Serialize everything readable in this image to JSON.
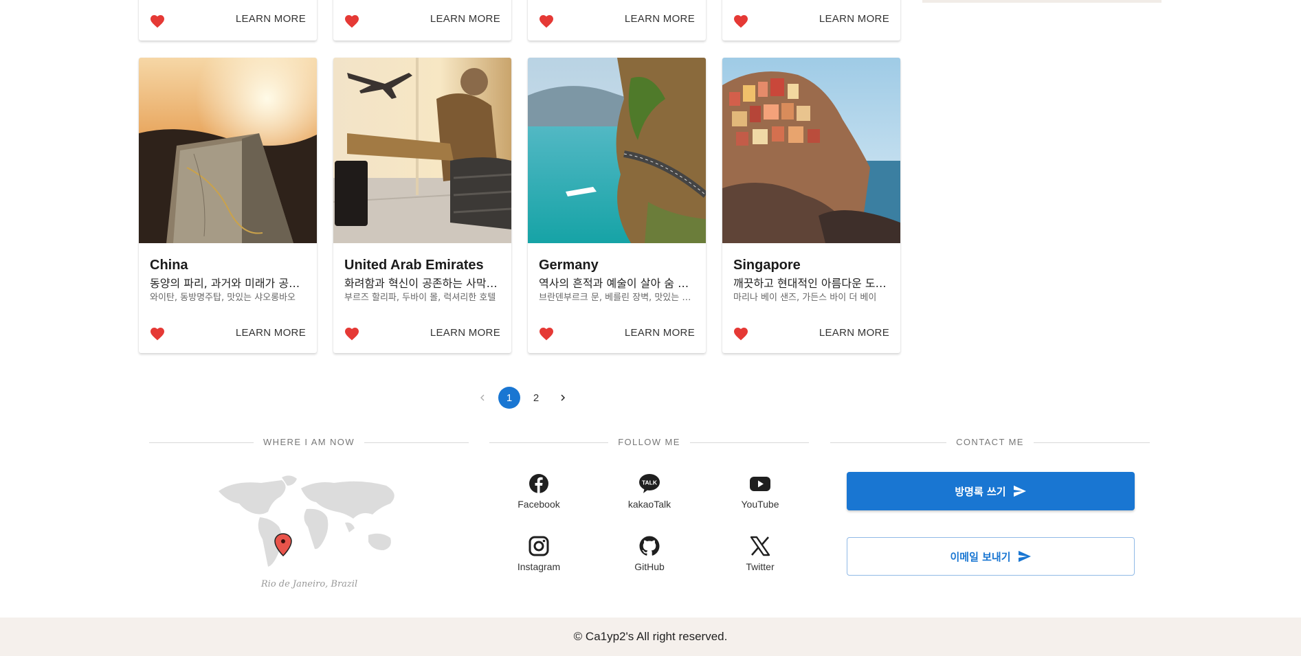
{
  "colors": {
    "accent": "#1976d2",
    "heart": "#e53935",
    "footer_bg": "#f5f0ec"
  },
  "top_row_cards": [
    {
      "learn_more": "LEARN MORE"
    },
    {
      "learn_more": "LEARN MORE"
    },
    {
      "learn_more": "LEARN MORE"
    },
    {
      "learn_more": "LEARN MORE"
    }
  ],
  "cards": [
    {
      "title": "China",
      "subtitle": "동양의 파리, 과거와 미래가 공존하는 도시",
      "description": "와이탄, 동방명주탑, 맛있는 샤오롱바오",
      "learn_more": "LEARN MORE",
      "image": "map-on-dashboard-photo"
    },
    {
      "title": "United Arab Emirates",
      "subtitle": "화려함과 혁신이 공존하는 사막의 도시",
      "description": "부르즈 할리파, 두바이 몰, 럭셔리한 호텔",
      "learn_more": "LEARN MORE",
      "image": "airport-traveler-photo"
    },
    {
      "title": "Germany",
      "subtitle": "역사의 흔적과 예술이 살아 숨 쉬는 나라",
      "description": "브란덴부르크 문, 베를린 장벽, 맛있는 맥주",
      "learn_more": "LEARN MORE",
      "image": "coastal-road-photo"
    },
    {
      "title": "Singapore",
      "subtitle": "깨끗하고 현대적인 아름다운 도시 국가",
      "description": "마리나 베이 샌즈, 가든스 바이 더 베이",
      "learn_more": "LEARN MORE",
      "image": "cliffside-village-photo"
    }
  ],
  "pagination": {
    "pages": [
      "1",
      "2"
    ],
    "current": "1"
  },
  "footer": {
    "where_title": "WHERE I AM NOW",
    "location": "Rio de Janeiro, Brazil",
    "follow_title": "FOLLOW ME",
    "socials": [
      {
        "label": "Facebook",
        "icon": "facebook-icon"
      },
      {
        "label": "kakaoTalk",
        "icon": "kakaotalk-icon"
      },
      {
        "label": "YouTube",
        "icon": "youtube-icon"
      },
      {
        "label": "Instagram",
        "icon": "instagram-icon"
      },
      {
        "label": "GitHub",
        "icon": "github-icon"
      },
      {
        "label": "Twitter",
        "icon": "x-twitter-icon"
      }
    ],
    "contact_title": "CONTACT ME",
    "guestbook_button": "방명록 쓰기",
    "email_button": "이메일 보내기",
    "kakao_icon_text": "TALK",
    "copyright": "© Ca1yp2's All right reserved."
  }
}
